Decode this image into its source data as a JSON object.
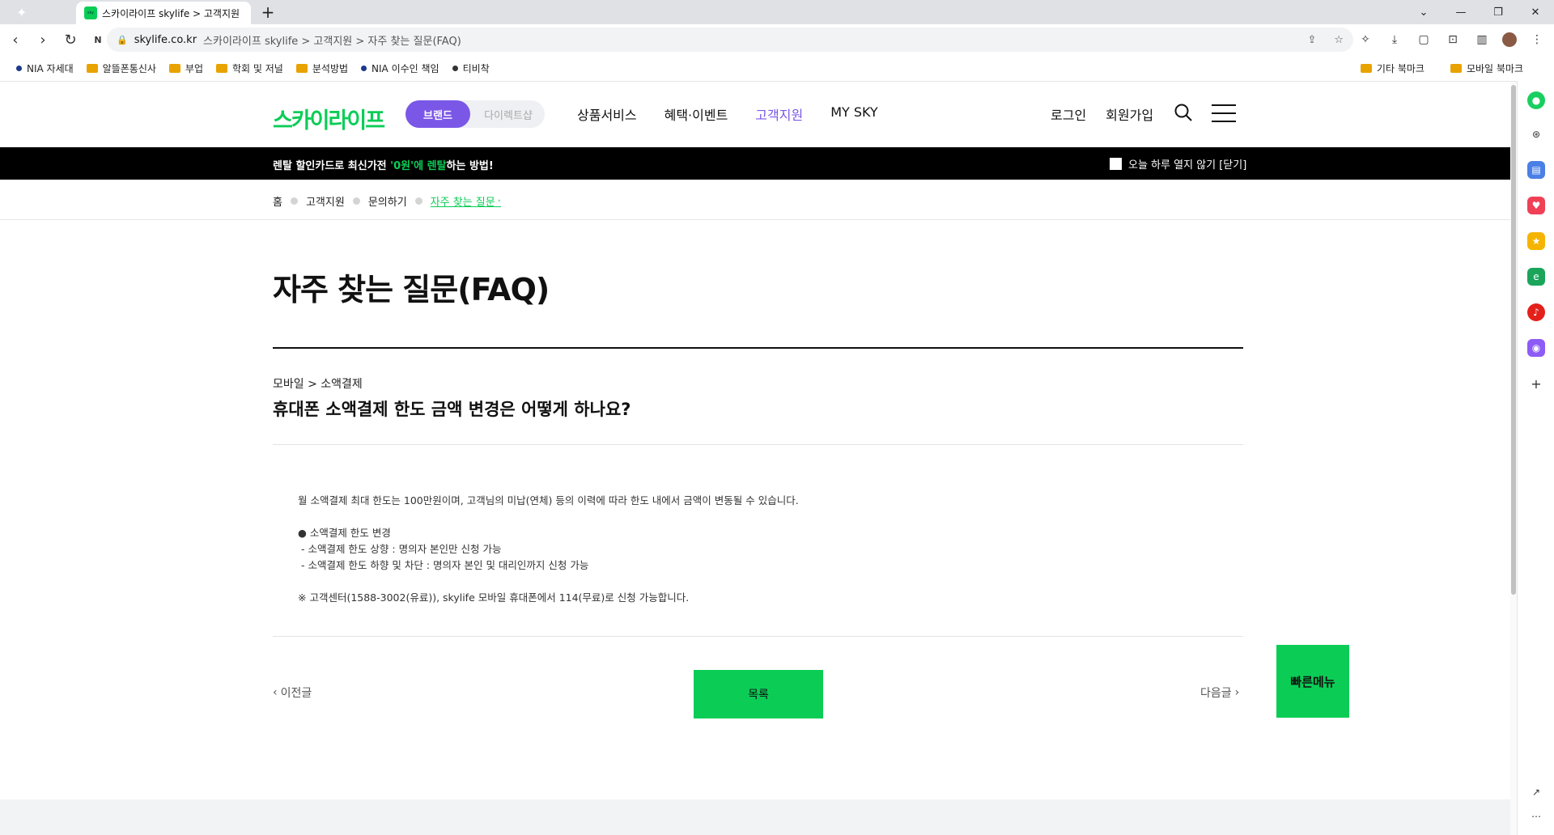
{
  "browser": {
    "tab_title": "스카이라이프 skylife > 고객지원",
    "new_tab": "+",
    "url_domain": "skylife.co.kr",
    "url_rest": "스카이라이프 skylife > 고객지원 > 자주 찾는 질문(FAQ)",
    "bookmarks": [
      "NIA 자세대",
      "알뜰폰통신사",
      "부업",
      "학회 및 저널",
      "분석방법",
      "NIA 이수인 책임",
      "티비착"
    ],
    "bookmarks_right": [
      "기타 북마크",
      "모바일 북마크"
    ]
  },
  "header": {
    "logo": "스카이라이프",
    "toggle_on": "브랜드",
    "toggle_off": "다이렉트샵",
    "nav": [
      "상품서비스",
      "혜택·이벤트",
      "고객지원",
      "MY SKY"
    ],
    "login": "로그인",
    "signup": "회원가입"
  },
  "banner": {
    "text_before": "렌탈 할인카드로 최신가전 ",
    "text_green": "'0원'에 렌탈",
    "text_after": "하는 방법!",
    "close_text": "오늘 하루 열지 않기 [닫기]"
  },
  "breadcrumb": {
    "home": "홈",
    "support": "고객지원",
    "inquiry": "문의하기",
    "current": "자주 찾는 질문"
  },
  "content": {
    "page_title": "자주 찾는 질문(FAQ)",
    "category": "모바일 > 소액결제",
    "question": "휴대폰 소액결제 한도 금액 변경은 어떻게 하나요?",
    "answer_lines": [
      "월 소액결제 최대 한도는 100만원이며, 고객님의 미납(연체) 등의 이력에 따라 한도 내에서 금액이 변동될 수 있습니다.",
      "",
      "● 소액결제 한도 변경",
      " - 소액결제 한도 상향 : 명의자 본인만 신청 가능",
      " - 소액결제 한도 하향 및 차단 : 명의자 본인 및 대리인까지 신청 가능",
      "",
      "※ 고객센터(1588-3002(유료)), skylife 모바일 휴대폰에서 114(무료)로 신청 가능합니다."
    ],
    "prev": "이전글",
    "next": "다음글",
    "list_button": "목록",
    "quick_menu": "빠른메뉴"
  },
  "colors": {
    "brand_green": "#0bcd56",
    "brand_purple": "#7b57e8"
  }
}
